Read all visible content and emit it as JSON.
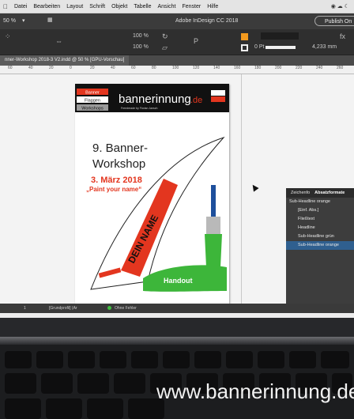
{
  "menubar": {
    "apple": "",
    "items": [
      "Datei",
      "Bearbeiten",
      "Layout",
      "Schrift",
      "Objekt",
      "Tabelle",
      "Ansicht",
      "Fenster",
      "Hilfe"
    ]
  },
  "app": {
    "title": "Adobe InDesign CC 2018",
    "zoom": "50 %",
    "publish": "Publish On"
  },
  "control": {
    "percent": "100 %",
    "pt": "0 Pt",
    "mm": "4,233 mm"
  },
  "document": {
    "tab": "nner-Workshop 2018-3 V2.indd @ 50 % [GPU-Vorschau]"
  },
  "ruler": {
    "ticks": [
      "60",
      "40",
      "20",
      "0",
      "20",
      "40",
      "60",
      "80",
      "100",
      "120",
      "140",
      "160",
      "180",
      "200",
      "220",
      "240",
      "260"
    ]
  },
  "poster": {
    "flag_labels": [
      "Banner",
      "Flaggen",
      "Workshops"
    ],
    "logo_main": "bannerinnung",
    "logo_tld": ".de",
    "logo_sub": "Freedreade by Florian Jansch",
    "title_line1": "9. Banner-",
    "title_line2": "Workshop",
    "date": "3. März 2018",
    "motto": "„Paint your name“",
    "name_text": "DEIN NAME",
    "handout": "Handout",
    "colors": {
      "red": "#e3361f",
      "green": "#3db63a",
      "blue": "#1e4f9c",
      "dark": "#111111"
    }
  },
  "statusbar": {
    "page": "1",
    "layout": "[Grundprofil] (Ar",
    "preflight": "Ohne Fehler"
  },
  "panel": {
    "tab1": "Zeichenfo",
    "tab2": "Absatzformate",
    "items": [
      "Sub-Headline orange",
      "[Einf. Abs.]",
      "Fließtext",
      "Headline",
      "Sub-Headline grün",
      "Sub-Headline orange"
    ]
  },
  "watermark": "www.bannerinnung.de"
}
